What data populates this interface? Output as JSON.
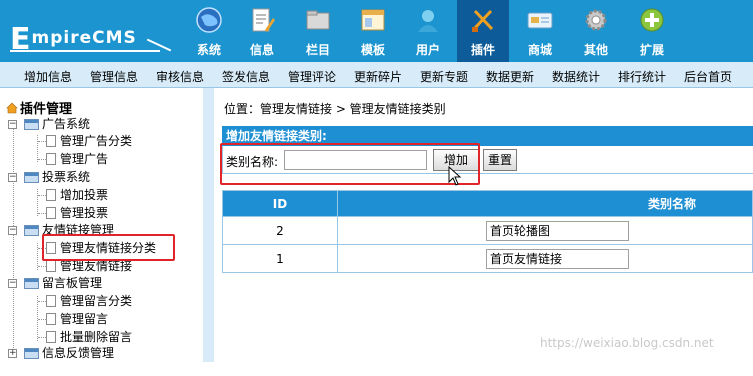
{
  "header": {
    "logo_big": "E",
    "logo_rest": "mpireCMS",
    "nav": [
      {
        "label": "系统",
        "icon": "globe-icon",
        "active": false
      },
      {
        "label": "信息",
        "icon": "document-edit-icon",
        "active": false
      },
      {
        "label": "栏目",
        "icon": "folder-icon",
        "active": false
      },
      {
        "label": "模板",
        "icon": "window-template-icon",
        "active": false
      },
      {
        "label": "用户",
        "icon": "user-icon",
        "active": false
      },
      {
        "label": "插件",
        "icon": "plugin-tools-icon",
        "active": true
      },
      {
        "label": "商城",
        "icon": "card-icon",
        "active": false
      },
      {
        "label": "其他",
        "icon": "gear-icon",
        "active": false
      },
      {
        "label": "扩展",
        "icon": "plus-circle-icon",
        "active": false
      }
    ]
  },
  "submenu": [
    "增加信息",
    "管理信息",
    "审核信息",
    "签发信息",
    "管理评论",
    "更新碎片",
    "更新专题",
    "数据更新",
    "数据统计",
    "排行统计",
    "后台首页"
  ],
  "tree": {
    "title": "插件管理",
    "groups": [
      {
        "label": "广告系统",
        "items": [
          "管理广告分类",
          "管理广告"
        ]
      },
      {
        "label": "投票系统",
        "items": [
          "增加投票",
          "管理投票"
        ]
      },
      {
        "label": "友情链接管理",
        "items": [
          "管理友情链接分类",
          "管理友情链接"
        ]
      },
      {
        "label": "留言板管理",
        "items": [
          "管理留言分类",
          "管理留言",
          "批量删除留言"
        ]
      },
      {
        "label": "信息反馈管理",
        "items": []
      }
    ]
  },
  "main": {
    "breadcrumb": "位置：管理友情链接 > 管理友情链接类别",
    "add_panel_title": "增加友情链接类别:",
    "field_label": "类别名称:",
    "name_input_value": "",
    "add_button": "增加",
    "reset_button": "重置",
    "table": {
      "headers": [
        "ID",
        "类别名称"
      ],
      "rows": [
        {
          "id": "2",
          "name": "首页轮播图"
        },
        {
          "id": "1",
          "name": "首页友情链接"
        }
      ]
    }
  },
  "watermark": "https://weixiao.blog.csdn.net",
  "colors": {
    "header_bg": "#1b94cf",
    "active_tab": "#0d5b98",
    "submenu_bg": "#d7ebf8",
    "panel_head": "#1f8fd3",
    "highlight": "#e0242a"
  }
}
